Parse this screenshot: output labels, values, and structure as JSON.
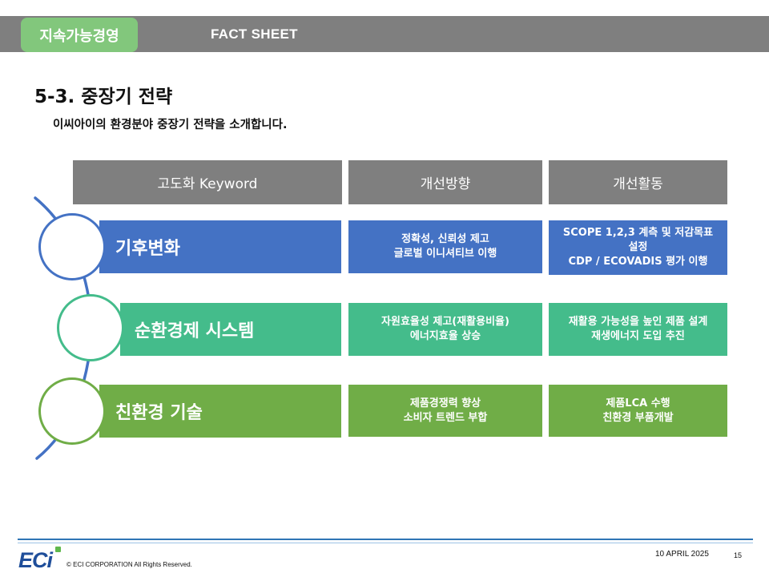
{
  "header": {
    "tag": "지속가능경영",
    "title": "FACT SHEET"
  },
  "page_title": "5-3. 중장기 전략",
  "subtitle": "이씨아이의 환경분야 중장기 전략을 소개합니다.",
  "columns": [
    "고도화 Keyword",
    "개선방향",
    "개선활동"
  ],
  "rows": [
    {
      "keyword": "기후변화",
      "direction": [
        "정확성, 신뢰성 제고",
        "글로벌 이니셔티브 이행"
      ],
      "activity": [
        "SCOPE 1,2,3 계측 및 저감목표",
        "설정",
        "CDP / ECOVADIS 평가 이행"
      ]
    },
    {
      "keyword": "순환경제 시스템",
      "direction": [
        "자원효율성 제고(재활용비율)",
        "에너지효율 상승"
      ],
      "activity": [
        "재활용 가능성을 높인 제품 설계",
        "재생에너지 도입 추진"
      ]
    },
    {
      "keyword": "친환경 기술",
      "direction": [
        "제품경쟁력 향상",
        "소비자 트렌드 부합"
      ],
      "activity": [
        "제품LCA 수행",
        "친환경 부품개발"
      ]
    }
  ],
  "colors": {
    "header_gray": "#7f7f7f",
    "tag_green": "#82c77c",
    "row1_blue": "#4472c4",
    "row2_teal": "#44bc8b",
    "row3_green": "#70ad47"
  },
  "footer": {
    "logo": "ECi",
    "copyright": "© ECI CORPORATION All Rights Reserved.",
    "date": "10 APRIL 2025",
    "page": "15"
  }
}
